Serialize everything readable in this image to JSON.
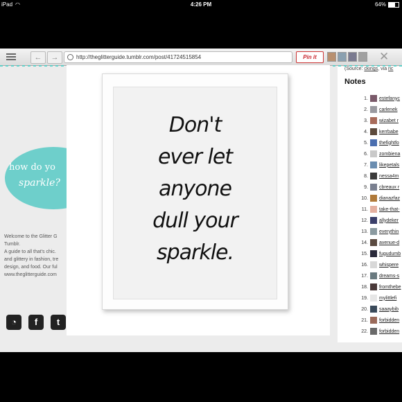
{
  "status": {
    "device": "iPad",
    "time": "4:26 PM",
    "battery": "64%"
  },
  "toolbar": {
    "url": "http://theglitterguide.tumblr.com/post/41724515854",
    "pin_label": "Pin it"
  },
  "sidebar": {
    "logo_line1": "how do yo",
    "logo_line2": "sparkle?",
    "welcome": [
      "Welcome to the Glitter G",
      "Tumblr.",
      "A guide to all that's chic.",
      "and glittery in fashion, tre",
      "design, and food. Our ful",
      "www.theglitterguide.com"
    ],
    "social": [
      "rss",
      "f",
      "t"
    ]
  },
  "artwork": {
    "lines": [
      "Don't",
      "ever let",
      "anyone",
      "dull your",
      "sparkle."
    ]
  },
  "notes_panel": {
    "source_prefix": "(Source: ",
    "source_link": "ckings",
    "source_via": ", via ",
    "source_link2": "ric",
    "heading": "Notes",
    "items": [
      {
        "n": "1.",
        "name": "estefanyc",
        "color": "#7a5a6a"
      },
      {
        "n": "2.",
        "name": "carlenek",
        "color": "#9a9aa0"
      },
      {
        "n": "3.",
        "name": "wizabet r",
        "color": "#a86b5a"
      },
      {
        "n": "4.",
        "name": "kerrbabe",
        "color": "#5d4a3c"
      },
      {
        "n": "5.",
        "name": "thefightfo",
        "color": "#4b6fb0"
      },
      {
        "n": "6.",
        "name": "zombiena",
        "color": "#c9c9c9"
      },
      {
        "n": "7.",
        "name": "likepetals",
        "color": "#6a8db0"
      },
      {
        "n": "8.",
        "name": "nessa4m",
        "color": "#3a3a3a"
      },
      {
        "n": "9.",
        "name": "cbreaux r",
        "color": "#7a8090"
      },
      {
        "n": "10.",
        "name": "dianazfaz",
        "color": "#b07a3a"
      },
      {
        "n": "11.",
        "name": "take-that-",
        "color": "#e4b0a0"
      },
      {
        "n": "12.",
        "name": "allydeker",
        "color": "#3a3f6a"
      },
      {
        "n": "13.",
        "name": "everythin",
        "color": "#8a9aa0"
      },
      {
        "n": "14.",
        "name": "avenue-d",
        "color": "#5a4a40"
      },
      {
        "n": "15.",
        "name": "fugudumb",
        "color": "#2a2a3a"
      },
      {
        "n": "16.",
        "name": "whispere",
        "color": "#d8d8d8"
      },
      {
        "n": "17.",
        "name": "dreams-s",
        "color": "#6a7a80"
      },
      {
        "n": "18.",
        "name": "fromthebe",
        "color": "#4a3a3a"
      },
      {
        "n": "19.",
        "name": "mylittlefi",
        "color": "#e6e6e6"
      },
      {
        "n": "20.",
        "name": "saaaybib",
        "color": "#3a4a5a"
      },
      {
        "n": "21.",
        "name": "forbidden",
        "color": "#9a6a5a"
      },
      {
        "n": "22.",
        "name": "forbidden",
        "color": "#6a6a6a"
      }
    ]
  }
}
